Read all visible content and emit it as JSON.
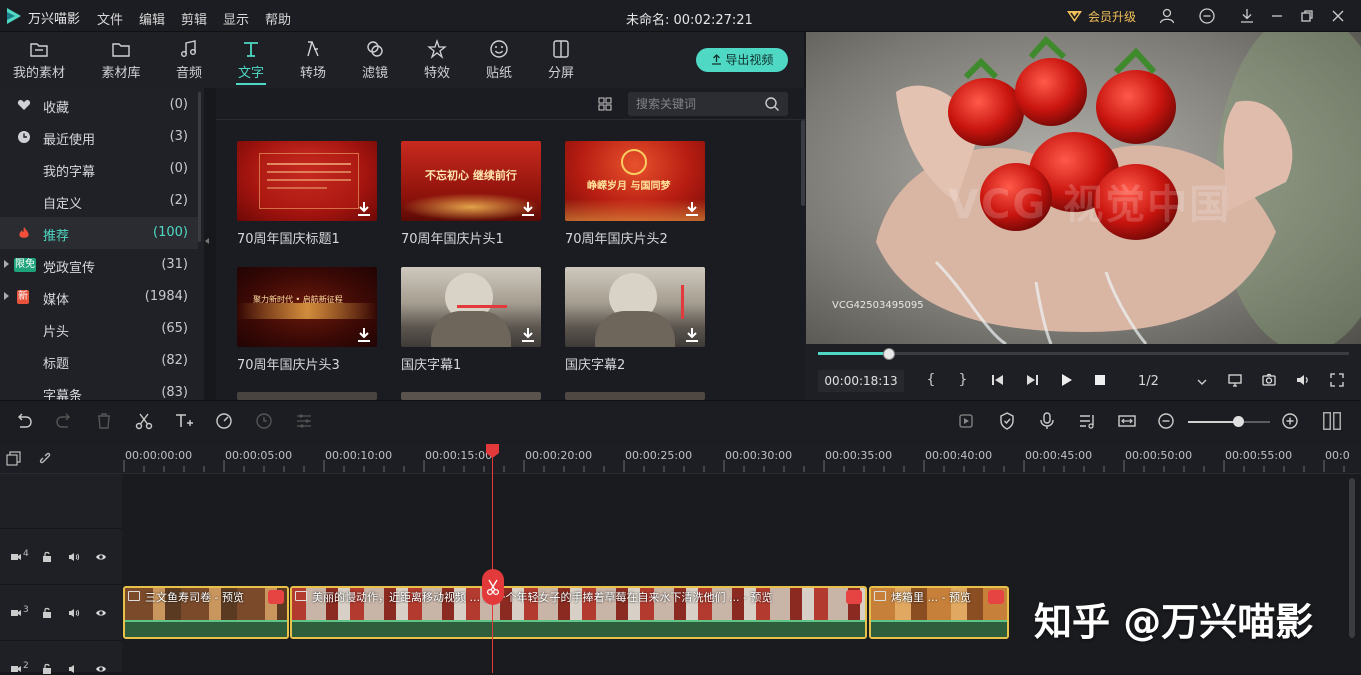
{
  "app": {
    "name": "万兴喵影",
    "menus": [
      "文件",
      "编辑",
      "剪辑",
      "显示",
      "帮助"
    ],
    "doc_title": "未命名: 00:02:27:21",
    "vip_label": "会员升级",
    "accent": "#4fd9c5"
  },
  "categories": [
    {
      "label": "我的素材",
      "icon": "folder-icon"
    },
    {
      "label": "素材库",
      "icon": "folder-library-icon"
    },
    {
      "label": "音频",
      "icon": "music-icon"
    },
    {
      "label": "文字",
      "icon": "text-icon",
      "active": true
    },
    {
      "label": "转场",
      "icon": "transition-icon"
    },
    {
      "label": "滤镜",
      "icon": "filter-icon"
    },
    {
      "label": "特效",
      "icon": "effect-icon"
    },
    {
      "label": "贴纸",
      "icon": "sticker-icon"
    },
    {
      "label": "分屏",
      "icon": "splitscreen-icon"
    }
  ],
  "export_label": "导出视频",
  "sidebar": [
    {
      "label": "收藏",
      "count": "(0)",
      "icon": "heart-icon"
    },
    {
      "label": "最近使用",
      "count": "(3)",
      "icon": "clock-icon"
    },
    {
      "label": "我的字幕",
      "count": "(0)"
    },
    {
      "label": "自定义",
      "count": "(2)"
    },
    {
      "label": "推荐",
      "count": "(100)",
      "icon": "fire-icon",
      "active": true
    },
    {
      "label": "党政宣传",
      "count": "(31)",
      "badge": "限免",
      "expandable": true
    },
    {
      "label": "媒体",
      "count": "(1984)",
      "badge": "新",
      "expandable": true
    },
    {
      "label": "片头",
      "count": "(65)"
    },
    {
      "label": "标题",
      "count": "(82)"
    },
    {
      "label": "字幕条",
      "count": "(83)"
    }
  ],
  "search": {
    "placeholder": "搜索关键词"
  },
  "tiles": [
    {
      "label": "70周年国庆标题1",
      "caption": ""
    },
    {
      "label": "70周年国庆片头1",
      "caption": "不忘初心 继续前行"
    },
    {
      "label": "70周年国庆片头2",
      "caption": "峥嵘岁月 与国同梦"
    },
    {
      "label": "70周年国庆片头3",
      "caption": "聚力新时代 • 启航新征程"
    },
    {
      "label": "国庆字幕1",
      "caption": ""
    },
    {
      "label": "国庆字幕2",
      "caption": ""
    }
  ],
  "preview": {
    "watermark": "VCG 视觉中国",
    "vcg_id": "VCG42503495095",
    "time": "00:00:18:13",
    "quality": "1/2",
    "progress": 0.13,
    "brackets": [
      "{",
      "}"
    ]
  },
  "timeline": {
    "ticks": [
      "00:00:00:00",
      "00:00:05:00",
      "00:00:10:00",
      "00:00:15:00",
      "00:00:20:00",
      "00:00:25:00",
      "00:00:30:00",
      "00:00:35:00",
      "00:00:40:00",
      "00:00:45:00",
      "00:00:50:00",
      "00:00:55:00",
      "00:0"
    ],
    "tracks": [
      {
        "num": "4"
      },
      {
        "num": "3"
      },
      {
        "num": "2"
      }
    ],
    "clips": [
      {
        "title": "三文鱼寿司卷 - 预览"
      },
      {
        "title": "美丽的慢动作，近距离移动视频 ... 的一个年轻女子的手捧着草莓在自来水下清洗他们 ... - 预览"
      },
      {
        "title": "烤箱里 ... - 预览"
      }
    ],
    "zoom_level": 0.6
  },
  "overlay": {
    "text": "知乎 @万兴喵影"
  }
}
